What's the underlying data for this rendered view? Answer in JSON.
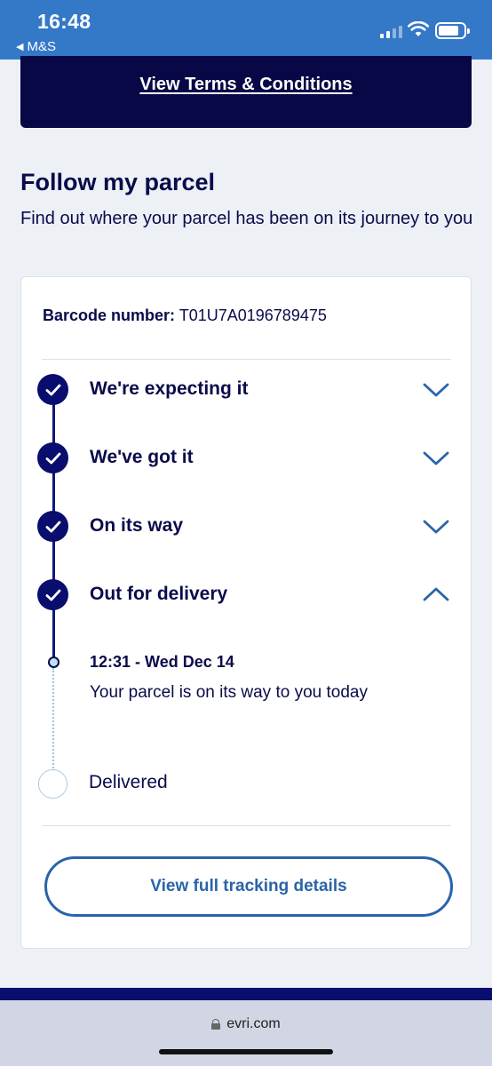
{
  "status_bar": {
    "time": "16:48",
    "back_app": "M&S",
    "back_icon": "back-triangle-icon"
  },
  "terms": {
    "link": "View Terms & Conditions"
  },
  "section": {
    "title": "Follow my parcel",
    "subtitle": "Find out where your parcel has been on its journey to you"
  },
  "card": {
    "barcode_label": "Barcode number:",
    "barcode_value": "T01U7A0196789475",
    "steps": [
      {
        "label": "We're expecting it",
        "status": "complete",
        "expanded": false
      },
      {
        "label": "We've got it",
        "status": "complete",
        "expanded": false
      },
      {
        "label": "On its way",
        "status": "complete",
        "expanded": false
      },
      {
        "label": "Out for delivery",
        "status": "complete",
        "expanded": true
      }
    ],
    "event": {
      "time": "12:31 - Wed Dec 14",
      "description": "Your parcel is on its way to you today"
    },
    "pending_step": {
      "label": "Delivered",
      "status": "pending"
    },
    "tracking_button": "View full tracking details"
  },
  "browser": {
    "url": "evri.com"
  },
  "colors": {
    "status_bar": "#3478c8",
    "navy": "#080846",
    "text": "#0a0b4a",
    "accent": "#2a64a8",
    "page_bg": "#edf1f6"
  }
}
